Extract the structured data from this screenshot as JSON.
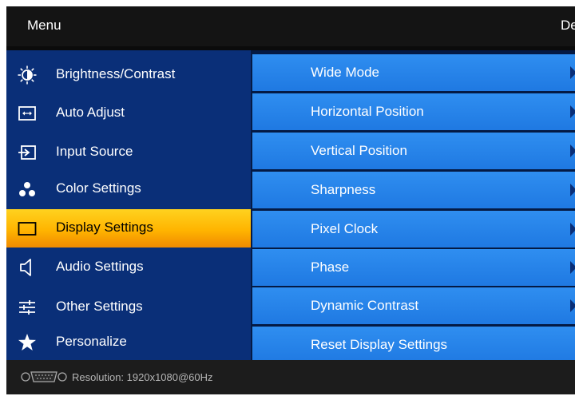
{
  "title_bar": {
    "menu_label": "Menu",
    "right_label": "De"
  },
  "menu": [
    {
      "label": "Brightness/Contrast",
      "icon": "sun-icon",
      "selected": false
    },
    {
      "label": "Auto Adjust",
      "icon": "auto-adjust-icon",
      "selected": false
    },
    {
      "label": "Input Source",
      "icon": "input-source-icon",
      "selected": false
    },
    {
      "label": "Color Settings",
      "icon": "color-dots-icon",
      "selected": false
    },
    {
      "label": "Display Settings",
      "icon": "display-icon",
      "selected": true
    },
    {
      "label": "Audio Settings",
      "icon": "speaker-icon",
      "selected": false
    },
    {
      "label": "Other Settings",
      "icon": "sliders-icon",
      "selected": false
    },
    {
      "label": "Personalize",
      "icon": "star-icon",
      "selected": false
    }
  ],
  "submenu": [
    {
      "label": "Wide Mode",
      "has_arrow": true
    },
    {
      "label": "Horizontal Position",
      "has_arrow": true
    },
    {
      "label": "Vertical Position",
      "has_arrow": true
    },
    {
      "label": "Sharpness",
      "has_arrow": true
    },
    {
      "label": "Pixel Clock",
      "has_arrow": true
    },
    {
      "label": "Phase",
      "has_arrow": true
    },
    {
      "label": "Dynamic Contrast",
      "has_arrow": true
    },
    {
      "label": "Reset Display Settings",
      "has_arrow": false
    }
  ],
  "status_bar": {
    "icon": "vga-connector-icon",
    "resolution_text": "Resolution:  1920x1080@60Hz"
  },
  "colors": {
    "left_panel": "#0a2f78",
    "selected_item": "#ffc000",
    "submenu_item": "#2a86ec",
    "title_bar": "#141414",
    "status_bar": "#1c1c1c"
  }
}
